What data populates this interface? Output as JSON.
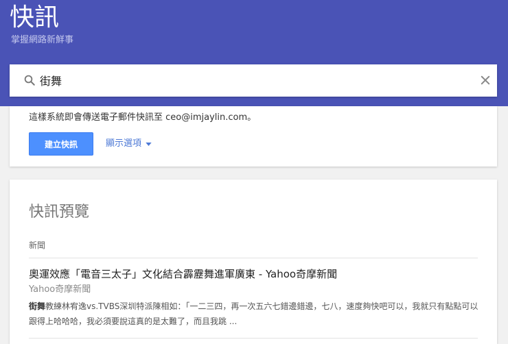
{
  "header": {
    "title": "快訊",
    "subtitle": "掌握網路新鮮事",
    "background": "#4a53b6"
  },
  "search": {
    "icon": "search-icon",
    "value": "街舞",
    "clear_icon": "close-icon"
  },
  "create_card": {
    "delivery_text": "這樣系統即會傳送電子郵件快訊至 ceo@imjaylin.com。",
    "create_button_label": "建立快訊",
    "options_label": "顯示選項",
    "options_icon": "caret-down-icon",
    "accent": "#4d90fe"
  },
  "preview": {
    "title": "快訊預覽",
    "section_label": "新聞",
    "articles": [
      {
        "title": "奧運效應「電音三太子」文化結合霹靂舞進軍廣東 - Yahoo奇摩新聞",
        "source": "Yahoo奇摩新聞",
        "snippet_keyword": "街舞",
        "snippet_text": "教練林宥逸vs.TVBS深圳特派陳相如：「一二三四，再一次五六七錯邊錯邊，七八，速度夠快吧可以，我就只有點點可以跟得上哈哈哈，我必須要說這真的是太難了，而且我跳 ..."
      }
    ]
  }
}
